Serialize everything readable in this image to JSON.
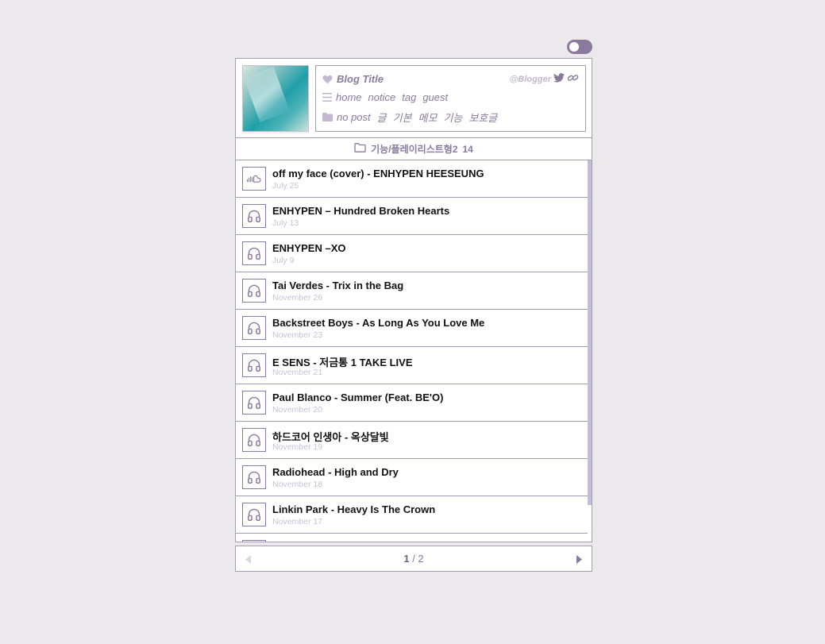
{
  "header": {
    "blog_title": "Blog Title",
    "blogger": "@Blogger",
    "nav": [
      "home",
      "notice",
      "tag",
      "guest"
    ],
    "categories": [
      "no post",
      "글",
      "기본",
      "메모",
      "기능",
      "보호글"
    ]
  },
  "folder": {
    "name": "기능/플레이리스트형2",
    "count": "14"
  },
  "items": [
    {
      "title": "off my face (cover) - ENHYPEN HEESEUNG",
      "date": "July 25",
      "icon": "soundcloud-icon"
    },
    {
      "title": "ENHYPEN – Hundred Broken Hearts",
      "date": "July 13",
      "icon": "headphones-icon"
    },
    {
      "title": "ENHYPEN –XO",
      "date": "July 9",
      "icon": "headphones-icon"
    },
    {
      "title": "Tai Verdes - Trix in the Bag",
      "date": "November 26",
      "icon": "headphones-icon"
    },
    {
      "title": "Backstreet Boys - As Long As You Love Me",
      "date": "November 23",
      "icon": "headphones-icon"
    },
    {
      "title": "E SENS - 저금통 1 TAKE LIVE",
      "date": "November 21",
      "icon": "headphones-icon"
    },
    {
      "title": "Paul Blanco - Summer (Feat. BE'O)",
      "date": "November 20",
      "icon": "headphones-icon"
    },
    {
      "title": "하드코어 인생아 - 옥상달빛",
      "date": "November 19",
      "icon": "headphones-icon"
    },
    {
      "title": "Radiohead - High and Dry",
      "date": "November 18",
      "icon": "headphones-icon"
    },
    {
      "title": "Linkin Park - Heavy Is The Crown",
      "date": "November 17",
      "icon": "headphones-icon"
    }
  ],
  "pager": {
    "current": "1",
    "separator": " / ",
    "total": "2"
  },
  "colors": {
    "accent": "#8a7a9e",
    "border": "#a89cb4",
    "date": "#c9c1d8",
    "background": "#ebe9ec"
  }
}
